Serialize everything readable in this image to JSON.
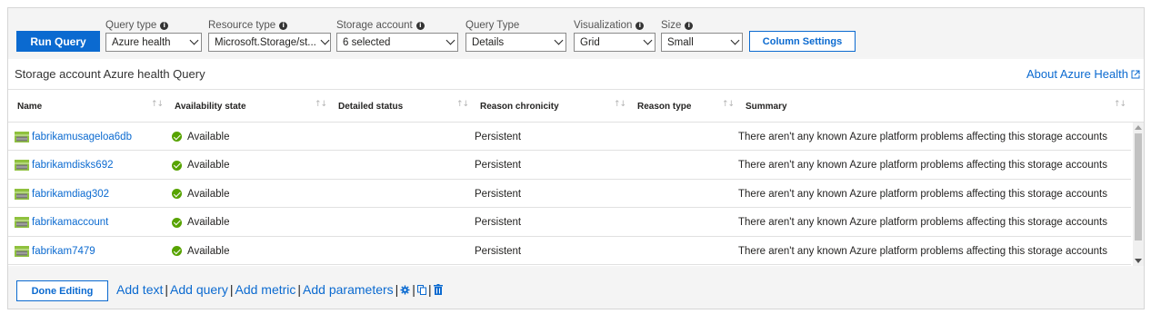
{
  "toolbar": {
    "run_label": "Run Query",
    "params": [
      {
        "label": "Query type",
        "value": "Azure health"
      },
      {
        "label": "Resource type",
        "value": "Microsoft.Storage/st..."
      },
      {
        "label": "Storage account",
        "value": "6 selected"
      },
      {
        "label": "Query Type",
        "value": "Details"
      },
      {
        "label": "Visualization",
        "value": "Grid"
      },
      {
        "label": "Size",
        "value": "Small"
      }
    ],
    "column_settings_label": "Column Settings"
  },
  "panel": {
    "title": "Storage account Azure health Query",
    "about_link": "About Azure Health"
  },
  "grid": {
    "columns": [
      "Name",
      "Availability state",
      "Detailed status",
      "Reason chronicity",
      "Reason type",
      "Summary"
    ],
    "rows": [
      {
        "name": "fabrikamusageloa6db",
        "availability": "Available",
        "detailed_status": "",
        "chronicity": "Persistent",
        "reason_type": "",
        "summary": "There aren't any known Azure platform problems affecting this storage accounts"
      },
      {
        "name": "fabrikamdisks692",
        "availability": "Available",
        "detailed_status": "",
        "chronicity": "Persistent",
        "reason_type": "",
        "summary": "There aren't any known Azure platform problems affecting this storage accounts"
      },
      {
        "name": "fabrikamdiag302",
        "availability": "Available",
        "detailed_status": "",
        "chronicity": "Persistent",
        "reason_type": "",
        "summary": "There aren't any known Azure platform problems affecting this storage accounts"
      },
      {
        "name": "fabrikamaccount",
        "availability": "Available",
        "detailed_status": "",
        "chronicity": "Persistent",
        "reason_type": "",
        "summary": "There aren't any known Azure platform problems affecting this storage accounts"
      },
      {
        "name": "fabrikam7479",
        "availability": "Available",
        "detailed_status": "",
        "chronicity": "Persistent",
        "reason_type": "",
        "summary": "There aren't any known Azure platform problems affecting this storage accounts"
      }
    ]
  },
  "footer": {
    "done_label": "Done Editing",
    "add_text": "Add text",
    "add_query": "Add query",
    "add_metric": "Add metric",
    "add_parameters": "Add parameters",
    "separator": "|",
    "icons": [
      "settings-icon",
      "copy-icon",
      "delete-icon"
    ]
  },
  "colors": {
    "accent": "#0b6ad0",
    "available": "#57a300",
    "storage_icon": "#8fc13e"
  }
}
